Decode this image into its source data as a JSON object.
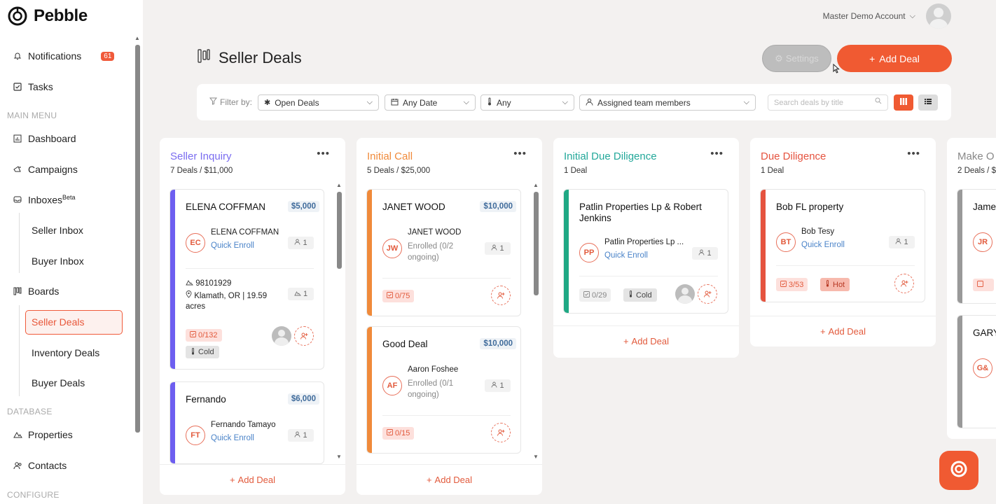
{
  "app": {
    "name": "Pebble"
  },
  "account": {
    "name": "Master Demo Account"
  },
  "sidebar": {
    "notifications": {
      "label": "Notifications",
      "badge": "61"
    },
    "tasks": "Tasks",
    "main_menu_label": "MAIN MENU",
    "dashboard": "Dashboard",
    "campaigns": "Campaigns",
    "inboxes": "Inboxes",
    "inboxes_sup": "Beta",
    "seller_inbox": "Seller Inbox",
    "buyer_inbox": "Buyer Inbox",
    "boards": "Boards",
    "seller_deals": "Seller Deals",
    "inventory_deals": "Inventory Deals",
    "buyer_deals": "Buyer Deals",
    "database_label": "DATABASE",
    "properties": "Properties",
    "contacts": "Contacts",
    "configure_label": "CONFIGURE"
  },
  "header": {
    "title": "Seller Deals",
    "settings_label": "Settings",
    "add_deal_label": "Add Deal"
  },
  "filters": {
    "label": "Filter by:",
    "status": "Open Deals",
    "date": "Any Date",
    "temperature": "Any",
    "team": "Assigned team members",
    "search_placeholder": "Search deals by title"
  },
  "columns": [
    {
      "title": "Seller Inquiry",
      "summary": "7 Deals / $11,000",
      "color": "#7a6cf0",
      "cards": [
        {
          "title": "ELENA COFFMAN",
          "amount": "$5,000",
          "initials": "EC",
          "contact": "ELENA COFFMAN",
          "link": "Quick Enroll",
          "count": "1",
          "parcel": "98101929",
          "location": "Klamath, OR | 19.59",
          "location2": "acres",
          "prop_count": "1",
          "tasks": "0/132",
          "temp": "Cold",
          "stripe": "#6d5ef0"
        },
        {
          "title": "Fernando",
          "amount": "$6,000",
          "initials": "FT",
          "contact": "Fernando Tamayo",
          "link": "Quick Enroll",
          "count": "1",
          "stripe": "#6d5ef0"
        }
      ],
      "footer": "Add Deal"
    },
    {
      "title": "Initial Call",
      "summary": "5 Deals / $25,000",
      "color": "#f08a3a",
      "cards": [
        {
          "title": "JANET WOOD",
          "amount": "$10,000",
          "initials": "JW",
          "contact": "JANET WOOD",
          "sub1": "Enrolled (0/2",
          "sub2": "ongoing)",
          "count": "1",
          "tasks": "0/75",
          "stripe": "#f08a3a"
        },
        {
          "title": "Good Deal",
          "amount": "$10,000",
          "initials": "AF",
          "contact": "Aaron Foshee",
          "sub1": "Enrolled (0/1",
          "sub2": "ongoing)",
          "count": "1",
          "tasks": "0/15",
          "stripe": "#f08a3a"
        }
      ],
      "footer": "Add Deal"
    },
    {
      "title": "Initial Due Diligence",
      "summary": "1 Deal",
      "color": "#23a89a",
      "cards": [
        {
          "title": "Patlin Properties Lp & Robert Jenkins",
          "initials": "PP",
          "contact": "Patlin Properties Lp ...",
          "link": "Quick Enroll",
          "count": "1",
          "tasks": "0/29",
          "temp": "Cold",
          "stripe": "#1fa884"
        }
      ],
      "footer": "Add Deal"
    },
    {
      "title": "Due Diligence",
      "summary": "1 Deal",
      "color": "#e5533f",
      "cards": [
        {
          "title": "Bob FL property",
          "initials": "BT",
          "contact": "Bob Tesy",
          "link": "Quick Enroll",
          "count": "1",
          "tasks": "3/53",
          "temp": "Hot",
          "stripe": "#e5533f"
        }
      ],
      "footer": "Add Deal"
    },
    {
      "title": "Make O",
      "summary": "2 Deals / $",
      "color": "#888",
      "cards": [
        {
          "title": "Jame",
          "initials": "JR",
          "stripe": "#999"
        },
        {
          "title": "GARY",
          "initials": "G&",
          "stripe": "#999"
        }
      ]
    }
  ]
}
